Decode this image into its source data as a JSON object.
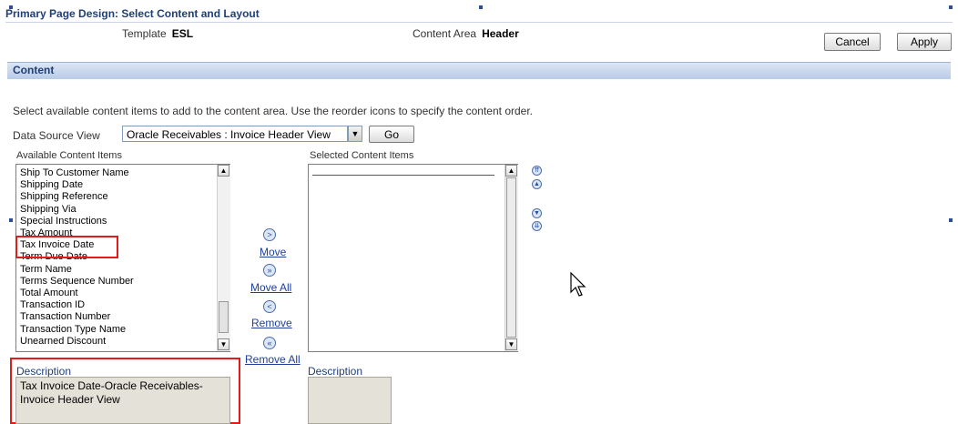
{
  "page": {
    "title": "Primary Page Design: Select Content and Layout",
    "template_label": "Template",
    "template_value": "ESL",
    "content_area_label": "Content Area",
    "content_area_value": "Header",
    "cancel_label": "Cancel",
    "apply_label": "Apply"
  },
  "section": {
    "title": "Content",
    "instructions": "Select available content items to add to the content area. Use the reorder icons to specify the content order."
  },
  "data_source": {
    "label": "Data Source View",
    "selected": "Oracle Receivables : Invoice Header View",
    "go_label": "Go"
  },
  "available": {
    "label": "Available Content Items",
    "items": [
      "Ship To Customer Name",
      "Shipping Date",
      "Shipping Reference",
      "Shipping Via",
      "Special Instructions",
      "Tax Amount",
      "Tax Invoice Date",
      "Term Due Date",
      "Term Name",
      "Terms Sequence Number",
      "Total Amount",
      "Transaction ID",
      "Transaction Number",
      "Transaction Type Name",
      "Unearned Discount"
    ]
  },
  "selected": {
    "label": "Selected Content Items"
  },
  "shuttle": {
    "move": "Move",
    "move_all": "Move All",
    "remove": "Remove",
    "remove_all": "Remove All"
  },
  "description": {
    "left_label": "Description",
    "left_text": "Tax Invoice Date-Oracle Receivables-Invoice Header View",
    "right_label": "Description",
    "right_text": ""
  },
  "icons": {
    "move": "move-right-icon",
    "move_all": "move-all-right-icon",
    "remove": "remove-left-icon",
    "remove_all": "remove-all-left-icon",
    "move_top": "move-top-icon",
    "move_up": "move-up-icon",
    "move_down": "move-down-icon",
    "move_bottom": "move-bottom-icon",
    "cursor": "mouse-pointer-icon"
  },
  "colors": {
    "highlight_box": "#e01c1c",
    "section_bar": "#b9cbe6",
    "link": "#1f3f9a"
  }
}
